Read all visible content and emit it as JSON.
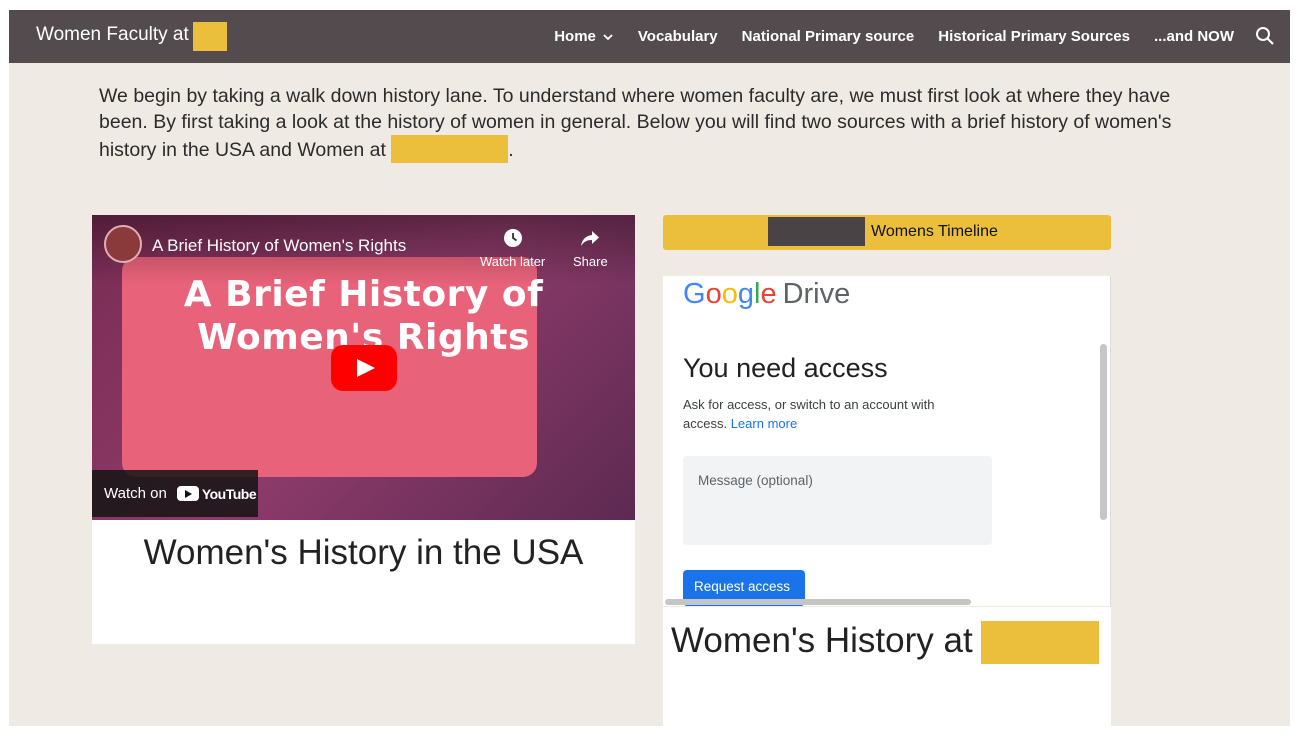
{
  "header": {
    "site_title": "Women Faculty at",
    "nav": [
      {
        "label": "Home",
        "has_dropdown": true
      },
      {
        "label": "Vocabulary"
      },
      {
        "label": "National Primary source"
      },
      {
        "label": "Historical Primary Sources"
      },
      {
        "label": "...and NOW"
      }
    ],
    "search_icon": "search-icon"
  },
  "intro": {
    "text": "We begin by taking a walk down history lane. To understand where women faculty are, we must first look at where they have been. By first taking a look at the history of women in general. Below you will find two sources with a brief history of women's history in the USA and Women at",
    "end": "."
  },
  "video": {
    "title": "A Brief History of Women's Rights",
    "thumbnail_line1": "A Brief History of",
    "thumbnail_line2": "Women's Rights",
    "watch_later": "Watch later",
    "share": "Share",
    "watch_on": "Watch on",
    "youtube": "YouTube"
  },
  "video_caption": "Women's History in the USA",
  "timeline": {
    "label": "Womens Timeline"
  },
  "drive": {
    "logo_letters": [
      "G",
      "o",
      "o",
      "g",
      "l",
      "e"
    ],
    "logo_product": "Drive",
    "heading": "You need access",
    "ask_text": "Ask for access, or switch to an account with access.",
    "learn_more": "Learn more",
    "message_placeholder": "Message (optional)",
    "request_button": "Request access"
  },
  "history_caption": "Women's History at",
  "colors": {
    "nav_bg": "#544b4f",
    "page_bg": "#efebe4",
    "redaction": "#ebbe3c",
    "play_red": "#ff0000",
    "link_blue": "#1a73e8"
  }
}
